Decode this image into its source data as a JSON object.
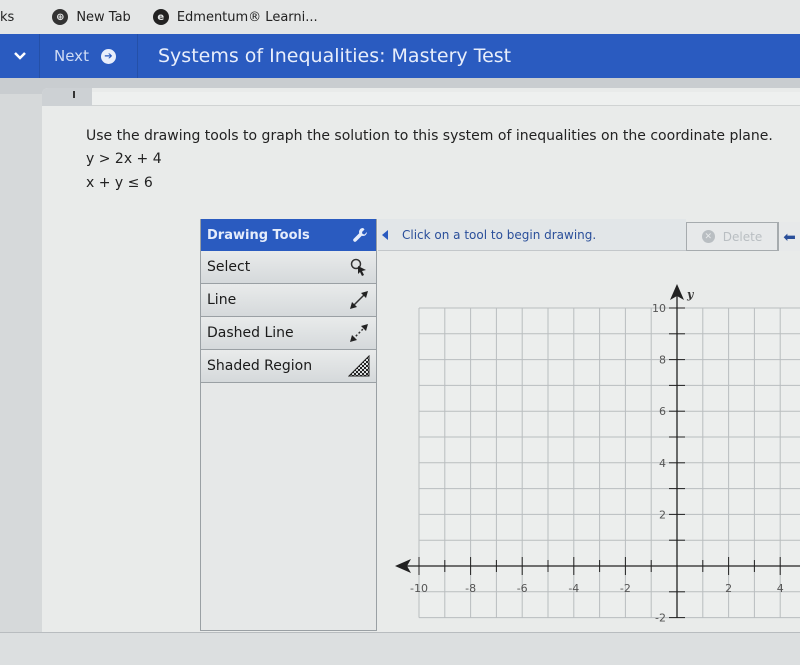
{
  "bookmarks": [
    {
      "label": "ks",
      "icon": "none"
    },
    {
      "label": "New Tab",
      "icon": "globe-icon"
    },
    {
      "label": "Edmentum® Learni...",
      "icon": "edmentum-logo-icon"
    }
  ],
  "topbar": {
    "menu_icon": "chevron-down-icon",
    "next_label": "Next",
    "next_icon": "arrow-right-circle-icon",
    "title": "Systems of Inequalities: Mastery Test"
  },
  "question": {
    "prompt": "Use the drawing tools to graph the solution to this system of inequalities on the coordinate plane.",
    "inequalities": [
      "y > 2x + 4",
      "x + y ≤ 6"
    ]
  },
  "drawing_tools": {
    "header": "Drawing Tools",
    "header_icon": "wrench-icon",
    "items": [
      {
        "label": "Select",
        "icon": "select-pointer-icon"
      },
      {
        "label": "Line",
        "icon": "line-arrows-icon"
      },
      {
        "label": "Dashed Line",
        "icon": "dashed-line-arrows-icon"
      },
      {
        "label": "Shaded Region",
        "icon": "shaded-region-icon"
      }
    ]
  },
  "toolbar": {
    "status": "Click on a tool to begin drawing.",
    "delete_label": "Delete",
    "delete_enabled": false,
    "undo_icon": "undo-arrow-icon"
  },
  "graph": {
    "x_axis_ticks": [
      "-10",
      "-8",
      "-6",
      "-4",
      "-2",
      "2",
      "4"
    ],
    "y_axis_ticks": [
      "10",
      "8",
      "6",
      "4",
      "2",
      "-2"
    ],
    "y_axis_label": "y",
    "x_range_visible": [
      -10,
      4
    ],
    "y_range_visible": [
      -2,
      10
    ],
    "grid_step": 1,
    "label_step": 2
  },
  "colors": {
    "brand_blue": "#2a5bc0",
    "status_text": "#2a4f9a",
    "grid": "#b9bdbf",
    "axis": "#222222"
  }
}
